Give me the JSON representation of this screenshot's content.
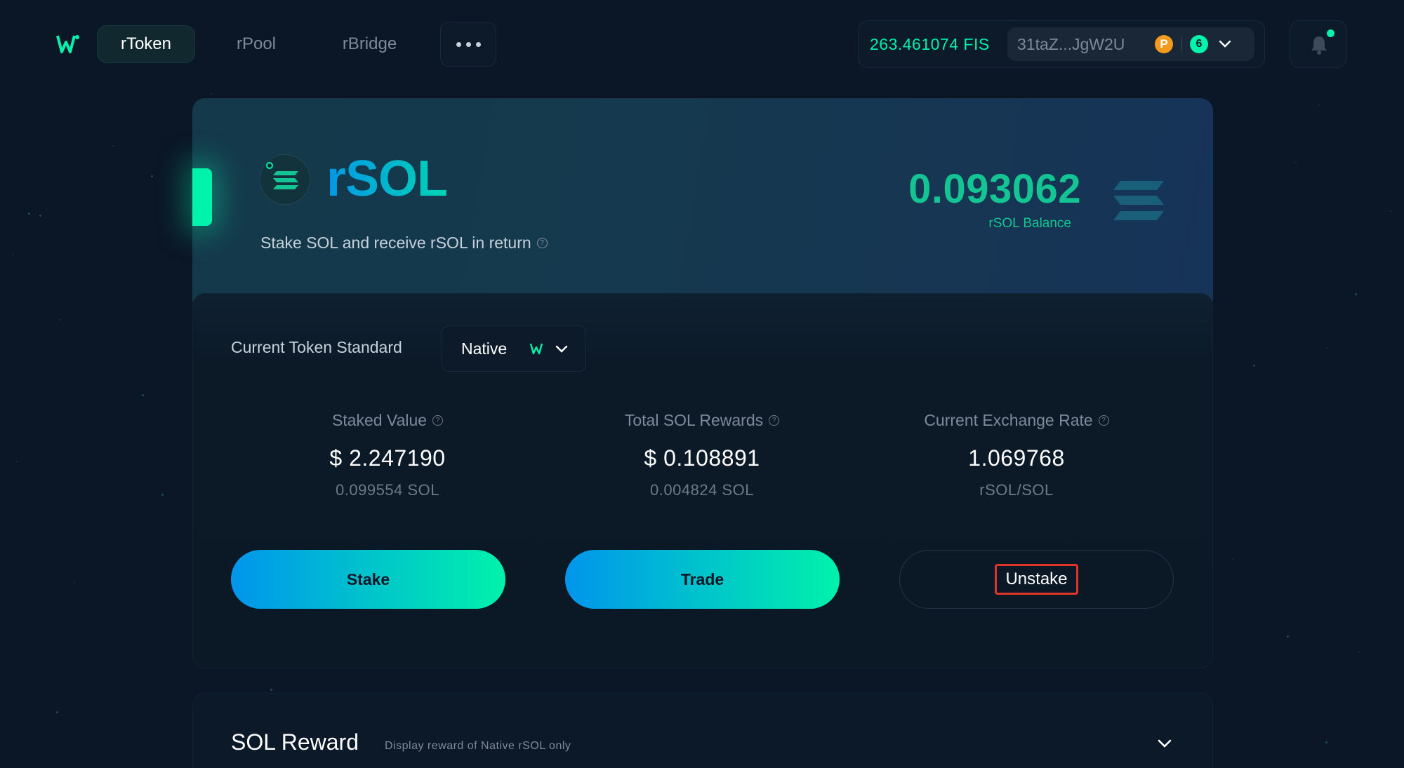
{
  "nav": {
    "tabs": [
      {
        "label": "rToken",
        "active": true
      },
      {
        "label": "rPool",
        "active": false
      },
      {
        "label": "rBridge",
        "active": false
      }
    ],
    "more_icon": "more-dots-icon"
  },
  "wallet": {
    "fis_balance": "263.461074 FIS",
    "address": "31taZ...JgW2U",
    "network_icon": "polkadot-icon",
    "network_glyph": "P",
    "notification_count": "6"
  },
  "token": {
    "title": "rSOL",
    "subtitle": "Stake SOL and receive rSOL in return",
    "balance_value": "0.093062",
    "balance_label": "rSOL Balance"
  },
  "standard": {
    "label": "Current Token Standard",
    "value": "Native"
  },
  "stats": [
    {
      "label": "Staked Value",
      "value": "$ 2.247190",
      "sub": "0.099554 SOL"
    },
    {
      "label": "Total SOL Rewards",
      "value": "$ 0.108891",
      "sub": "0.004824 SOL"
    },
    {
      "label": "Current Exchange Rate",
      "value": "1.069768",
      "sub": "rSOL/SOL"
    }
  ],
  "actions": {
    "stake": "Stake",
    "trade": "Trade",
    "unstake": "Unstake"
  },
  "reward": {
    "title": "SOL Reward",
    "subtitle": "Display reward of Native rSOL only"
  },
  "colors": {
    "background": "#0b1626",
    "accent": "#00f3ab",
    "gradient_start": "#0095ec",
    "gradient_end": "#00f2ab",
    "highlight_box": "#e0332a"
  }
}
